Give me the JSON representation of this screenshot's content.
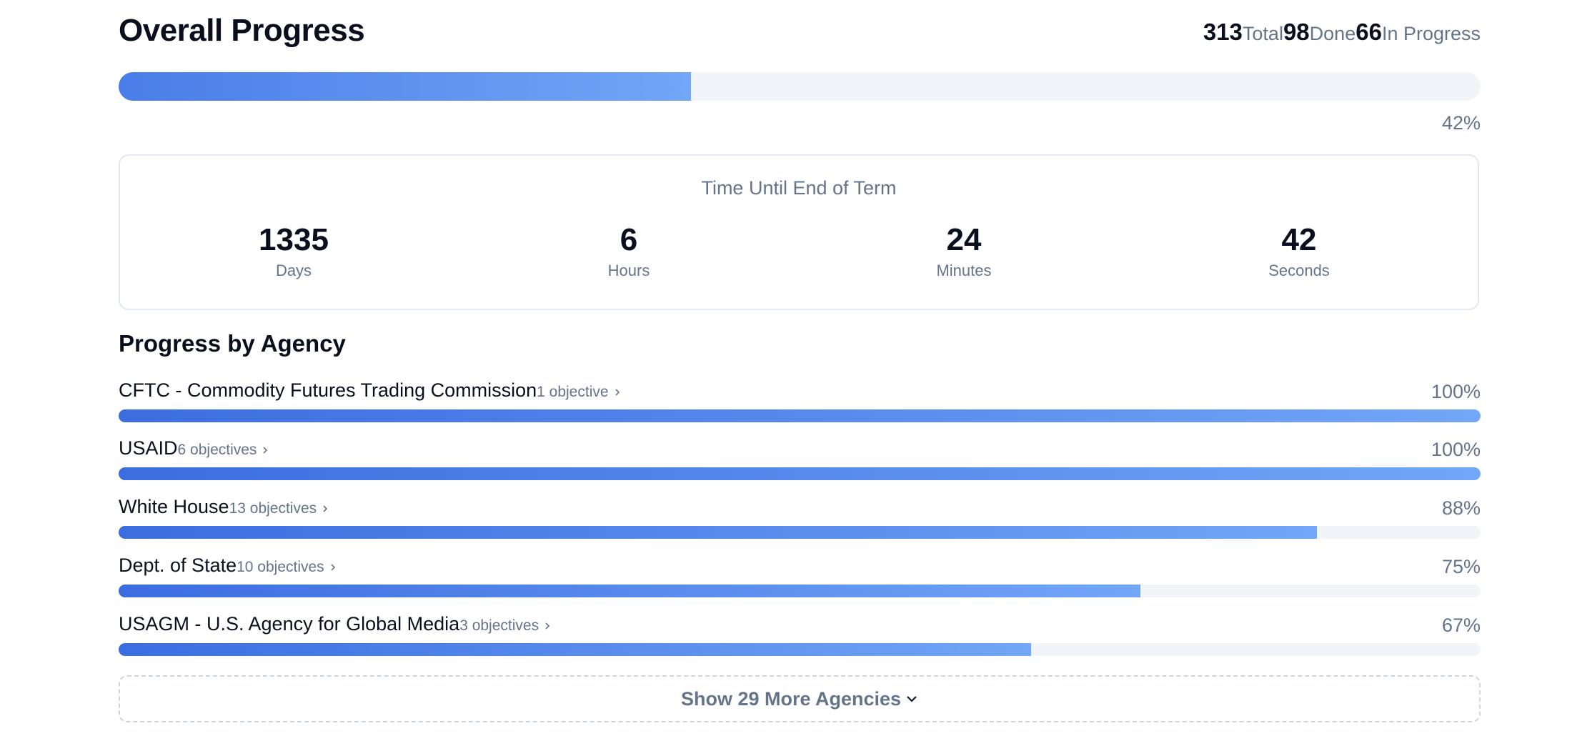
{
  "header": {
    "title": "Overall Progress",
    "stats": [
      {
        "value": "313",
        "label": "Total"
      },
      {
        "value": "98",
        "label": "Done"
      },
      {
        "value": "66",
        "label": "In Progress"
      }
    ]
  },
  "overall": {
    "percent_label": "42%",
    "percent": 42
  },
  "countdown": {
    "title": "Time Until End of Term",
    "units": [
      {
        "value": "1335",
        "label": "Days"
      },
      {
        "value": "6",
        "label": "Hours"
      },
      {
        "value": "24",
        "label": "Minutes"
      },
      {
        "value": "42",
        "label": "Seconds"
      }
    ]
  },
  "agencies": {
    "title": "Progress by Agency",
    "items": [
      {
        "name": "CFTC - Commodity Futures Trading Commission",
        "objectives": "1 objective",
        "percent_label": "100%",
        "percent": 100
      },
      {
        "name": "USAID",
        "objectives": "6 objectives",
        "percent_label": "100%",
        "percent": 100
      },
      {
        "name": "White House",
        "objectives": "13 objectives",
        "percent_label": "88%",
        "percent": 88
      },
      {
        "name": "Dept. of State",
        "objectives": "10 objectives",
        "percent_label": "75%",
        "percent": 75
      },
      {
        "name": "USAGM - U.S. Agency for Global Media",
        "objectives": "3 objectives",
        "percent_label": "67%",
        "percent": 67
      }
    ],
    "show_more_label": "Show 29 More Agencies"
  },
  "colors": {
    "bar_start": "#3b6de0",
    "bar_end": "#72a6f6",
    "track": "#f1f5f9",
    "muted_text": "#64748b"
  }
}
